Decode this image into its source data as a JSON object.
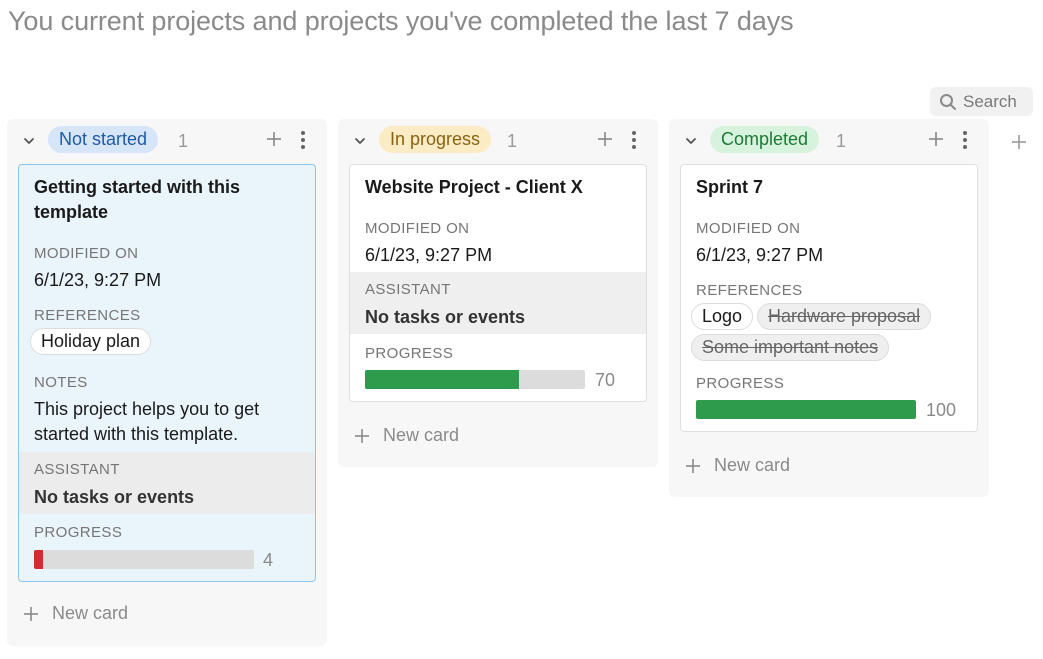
{
  "page": {
    "subtitle": "You current projects and projects you've completed the last 7 days"
  },
  "toolbar": {
    "search_label": "Search",
    "search_icon": "search-icon"
  },
  "labels": {
    "modified_on": "MODIFIED ON",
    "references": "REFERENCES",
    "notes": "NOTES",
    "assistant": "ASSISTANT",
    "progress": "PROGRESS",
    "new_card": "New card"
  },
  "columns": [
    {
      "status": "Not started",
      "count": "1",
      "tag_bg": "#d6e6f8",
      "tag_color": "#1f5aa6",
      "card": {
        "title_line1": "Getting started with this",
        "title_line2": "template",
        "modified": "6/1/23, 9:27 PM",
        "references": [
          "Holiday plan"
        ],
        "notes_line1": "This project helps you to get",
        "notes_line2": "started with this template.",
        "assistant": "No tasks or events",
        "progress": 4,
        "progress_label": "4",
        "progress_color": "#d22d2d"
      }
    },
    {
      "status": "In progress",
      "count": "1",
      "tag_bg": "#fbecc5",
      "tag_color": "#8a6212",
      "card": {
        "title": "Website Project - Client X",
        "modified": "6/1/23, 9:27 PM",
        "assistant": "No tasks or events",
        "progress": 70,
        "progress_label": "70",
        "progress_color": "#2e9a4b"
      }
    },
    {
      "status": "Completed",
      "count": "1",
      "tag_bg": "#d8f3dd",
      "tag_color": "#1d7a36",
      "card": {
        "title": "Sprint 7",
        "modified": "6/1/23, 9:27 PM",
        "references": [
          "Logo",
          "Hardware proposal",
          "Some important notes"
        ],
        "progress": 100,
        "progress_label": "100",
        "progress_color": "#2e9a4b"
      }
    }
  ]
}
